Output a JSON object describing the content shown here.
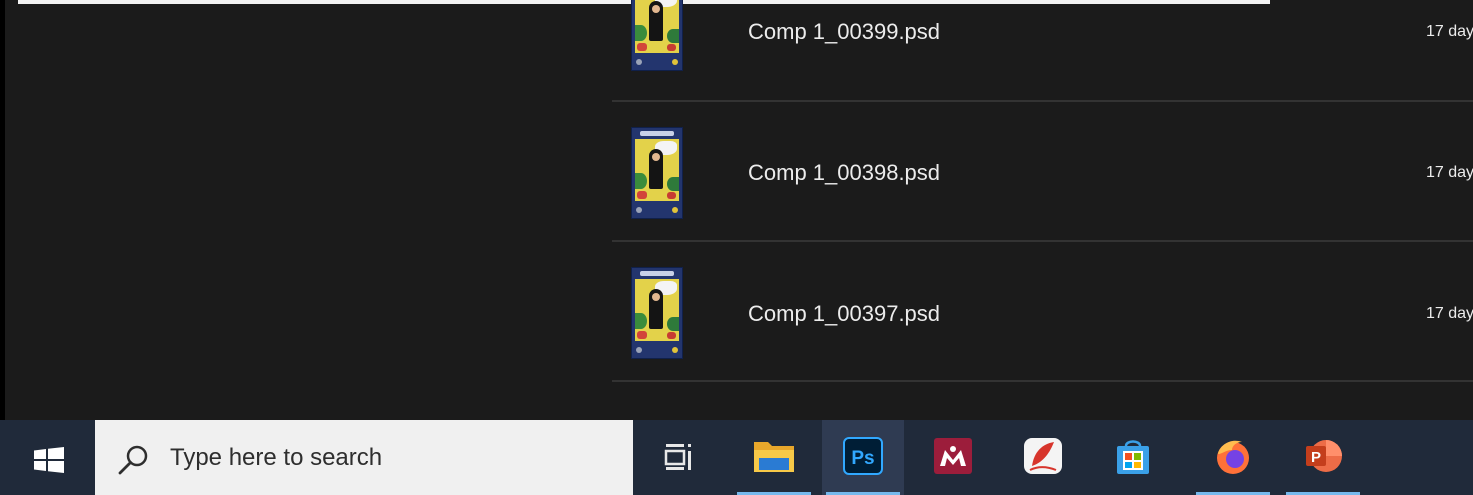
{
  "files": [
    {
      "name": "Comp 1_00399.psd",
      "date": "17 day"
    },
    {
      "name": "Comp 1_00398.psd",
      "date": "17 day"
    },
    {
      "name": "Comp 1_00397.psd",
      "date": "17 day"
    }
  ],
  "taskbar": {
    "search_placeholder": "Type here to search",
    "apps": [
      {
        "name": "file-explorer",
        "icon": "folder-icon",
        "running": true,
        "active": false
      },
      {
        "name": "photoshop",
        "icon": "photoshop-icon",
        "label": "Ps",
        "running": true,
        "active": true
      },
      {
        "name": "mendeley",
        "icon": "mendeley-icon",
        "running": false,
        "active": false
      },
      {
        "name": "pen-app",
        "icon": "pen-app-icon",
        "running": false,
        "active": false
      },
      {
        "name": "microsoft-store",
        "icon": "store-icon",
        "running": false,
        "active": false
      },
      {
        "name": "firefox",
        "icon": "firefox-icon",
        "running": true,
        "active": false
      },
      {
        "name": "powerpoint",
        "icon": "powerpoint-icon",
        "label": "P",
        "running": true,
        "active": false
      }
    ]
  },
  "colors": {
    "background": "#1b1b1b",
    "taskbar": "#202a3a",
    "running_indicator": "#76b9ed",
    "photoshop_blue": "#31a8ff",
    "mendeley_red": "#9c1d3b",
    "powerpoint_orange": "#d35230"
  }
}
